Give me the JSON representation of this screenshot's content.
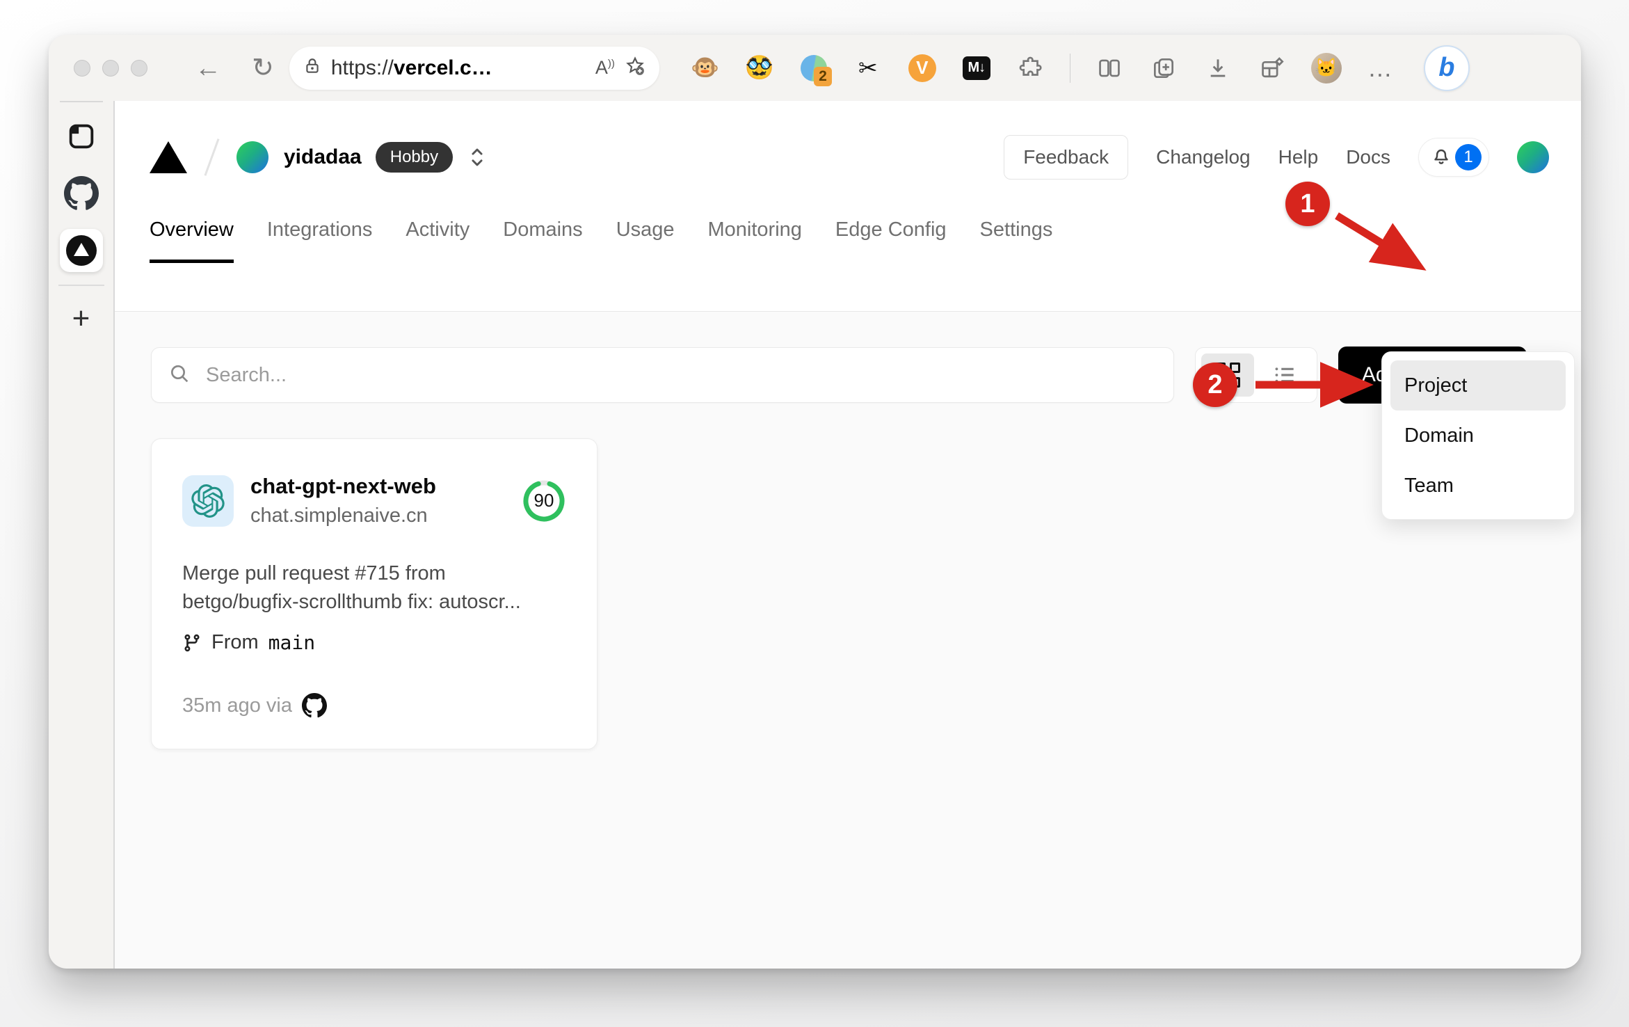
{
  "browser": {
    "back_glyph": "←",
    "refresh_glyph": "↻",
    "url": {
      "prefix": "https://",
      "domain": "vercel.c…"
    },
    "reader_glyph": "A",
    "extensions": {
      "tampermonkey_glyph": "🐵",
      "face_glyph": "🥸",
      "circle_badge_count": "2",
      "scissors_glyph": "✂",
      "v_glyph": "V",
      "markdown_glyph": "M↓",
      "avatar_glyph": "🐱",
      "more_glyph": "…",
      "bing_glyph": "b"
    }
  },
  "vercel": {
    "team": {
      "name": "yidadaa",
      "plan": "Hobby"
    },
    "header": {
      "feedback": "Feedback",
      "changelog": "Changelog",
      "help": "Help",
      "docs": "Docs",
      "notification_count": "1"
    },
    "tabs": [
      {
        "label": "Overview"
      },
      {
        "label": "Integrations"
      },
      {
        "label": "Activity"
      },
      {
        "label": "Domains"
      },
      {
        "label": "Usage"
      },
      {
        "label": "Monitoring"
      },
      {
        "label": "Edge Config"
      },
      {
        "label": "Settings"
      }
    ],
    "controls": {
      "search_placeholder": "Search...",
      "add_new_label": "Add New..."
    },
    "dropdown": {
      "items": [
        {
          "label": "Project"
        },
        {
          "label": "Domain"
        },
        {
          "label": "Team"
        }
      ]
    },
    "project": {
      "name": "chat-gpt-next-web",
      "domain": "chat.simplenaive.cn",
      "score": "90",
      "commit_line1": "Merge pull request #715 from",
      "commit_line2": "betgo/bugfix-scrollthumb fix: autoscr...",
      "branch_prefix": "From",
      "branch": "main",
      "meta": "35m ago via"
    }
  },
  "annotations": {
    "step1": "1",
    "step2": "2",
    "color": "#d7251d"
  },
  "colors": {
    "score_green": "#2fc05e",
    "badge_blue": "#0070f3",
    "add_new_bg": "#000000",
    "hobby_bg": "#333333"
  }
}
